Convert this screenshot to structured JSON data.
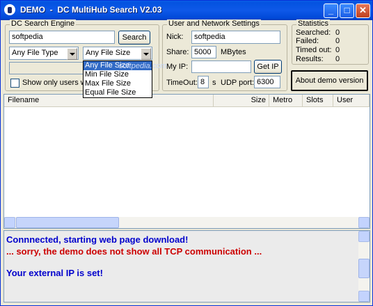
{
  "window": {
    "title": "DEMO  -  DC MultiHub Search V2.03",
    "buttons": {
      "minimize": "_",
      "maximize": "□",
      "close": "✕"
    }
  },
  "search_group": {
    "label": "DC Search Engine",
    "query": "softpedia",
    "search_button": "Search",
    "file_type": "Any File Type",
    "file_size": "Any File Size",
    "file_size_options": [
      "Any File Size",
      "Min File Size",
      "Max File Size",
      "Equal File Size"
    ],
    "show_only_users_label": "Show only users w"
  },
  "network_group": {
    "label": "User and Network Settings",
    "nick_label": "Nick:",
    "nick": "softpedia",
    "share_label": "Share:",
    "share": "5000",
    "share_unit": "MBytes",
    "myip_label": "My IP:",
    "myip": "",
    "getip_button": "Get IP",
    "timeout_label": "TimeOut:",
    "timeout": "8",
    "timeout_unit": "s",
    "udp_label": "UDP port:",
    "udp": "6300"
  },
  "stats_group": {
    "label": "Statistics",
    "searched_label": "Searched:",
    "searched": "0",
    "failed_label": "Failed:",
    "failed": "0",
    "timedout_label": "Timed out:",
    "timedout": "0",
    "results_label": "Results:",
    "results": "0"
  },
  "about_button": "About demo version",
  "results_table": {
    "columns": [
      "Filename",
      "Size",
      "Metro",
      "Slots",
      "User"
    ]
  },
  "log": {
    "lines": [
      {
        "text": "Connnected, starting web page download!",
        "color": "#0000cc"
      },
      {
        "text": " ... sorry, the demo does not show all TCP communication ...",
        "color": "#cc0000"
      },
      {
        "text": "",
        "color": "#000000"
      },
      {
        "text": "Your external IP is set!",
        "color": "#0000cc"
      }
    ]
  },
  "watermark": "softpedia.com"
}
